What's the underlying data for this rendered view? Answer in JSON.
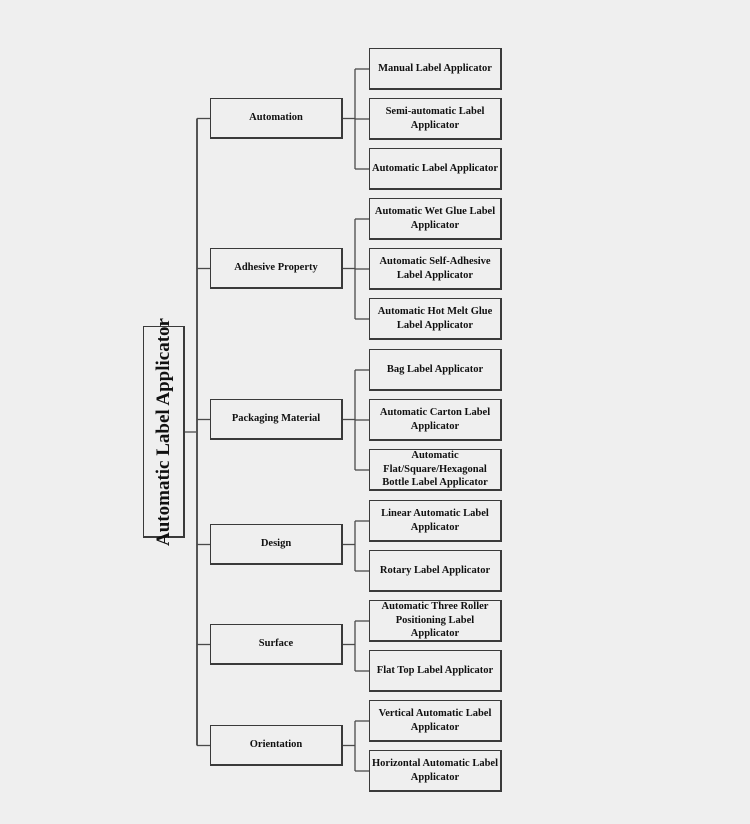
{
  "diagram": {
    "root": {
      "label": "Automatic Label Applicator"
    },
    "categories": [
      {
        "label": "Automation",
        "children": [
          "Manual Label Applicator",
          "Semi-automatic Label Applicator",
          "Automatic Label Applicator"
        ]
      },
      {
        "label": "Adhesive Property",
        "children": [
          "Automatic Wet Glue Label Applicator",
          "Automatic Self-Adhesive Label Applicator",
          "Automatic Hot Melt Glue Label Applicator"
        ]
      },
      {
        "label": "Packaging Material",
        "children": [
          "Bag Label Applicator",
          "Automatic Carton Label Applicator",
          "Automatic Flat/Square/Hexagonal Bottle Label Applicator"
        ]
      },
      {
        "label": "Design",
        "children": [
          "Linear Automatic Label Applicator",
          "Rotary Label Applicator"
        ]
      },
      {
        "label": "Surface",
        "children": [
          "Automatic Three Roller Positioning Label Applicator",
          "Flat Top Label Applicator"
        ]
      },
      {
        "label": "Orientation",
        "children": [
          "Vertical Automatic Label Applicator",
          "Horizontal Automatic Label Applicator"
        ]
      }
    ]
  }
}
